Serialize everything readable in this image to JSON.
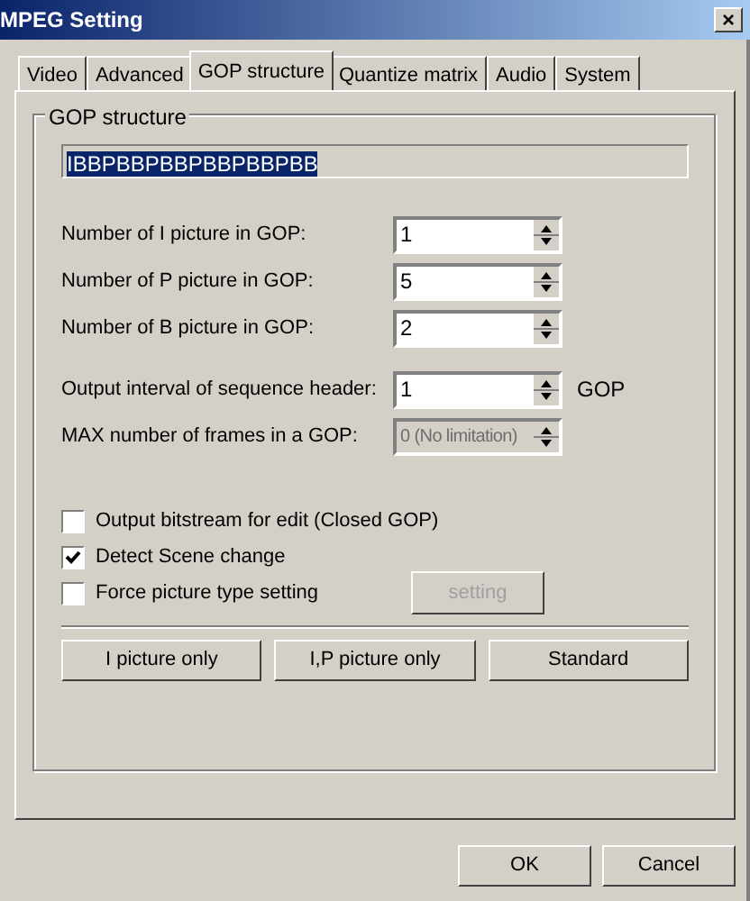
{
  "window": {
    "title": "MPEG Setting",
    "close": "×"
  },
  "tabs": [
    {
      "label": "Video",
      "selected": false
    },
    {
      "label": "Advanced",
      "selected": false
    },
    {
      "label": "GOP structure",
      "selected": true
    },
    {
      "label": "Quantize matrix",
      "selected": false
    },
    {
      "label": "Audio",
      "selected": false
    },
    {
      "label": "System",
      "selected": false
    }
  ],
  "group": {
    "title": "GOP structure",
    "pattern": "IBBPBBPBBPBBPBBPBB"
  },
  "fields": [
    {
      "label": "Number of I picture in GOP:",
      "value": "1",
      "disabled": false
    },
    {
      "label": "Number of P picture in GOP:",
      "value": "5",
      "disabled": false
    },
    {
      "label": "Number of B picture in GOP:",
      "value": "2",
      "disabled": false
    },
    {
      "label": "Output interval of sequence header:",
      "value": "1",
      "unit": "GOP",
      "disabled": false
    },
    {
      "label": "MAX number of frames in a GOP:",
      "value": "0 (No limitation)",
      "disabled": true
    }
  ],
  "checkboxes": [
    {
      "label": "Output bitstream for edit (Closed GOP)",
      "checked": false
    },
    {
      "label": "Detect Scene change",
      "checked": true
    },
    {
      "label": "Force picture type setting",
      "checked": false,
      "button": {
        "label": "setting",
        "disabled": true
      }
    }
  ],
  "preset_buttons": [
    "I picture only",
    "I,P picture only",
    "Standard"
  ],
  "buttons": [
    "OK",
    "Cancel"
  ]
}
